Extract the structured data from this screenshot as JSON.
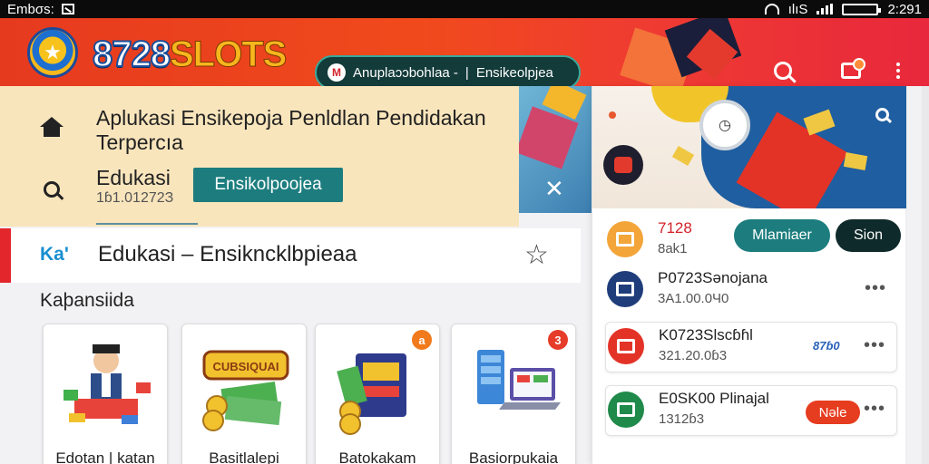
{
  "status_bar": {
    "left_text": "Embσs:",
    "time": "2:291",
    "network": "ılıS"
  },
  "header": {
    "logo_number": "8728",
    "logo_word": "SLOTS",
    "pill_icon": "M",
    "pill_left": "Anuplaɔɔbohlaa -",
    "pill_right": "Ensikeolpjea",
    "icons": [
      "search-icon",
      "chat-icon",
      "kebab-icon"
    ]
  },
  "hero": {
    "title": "Aplukasi Ensikepoja Penldlan Pendidakan Terpercıa",
    "edu_label": "Edukasi",
    "edu_sub": "1ɓ1.01272З",
    "edu_button": "Ensikolpoojea",
    "close_symbol": "✕"
  },
  "breadcrumb": {
    "prefix": "Ka'",
    "title": "Edukasi – Ensikncklbpieaa",
    "star": "☆"
  },
  "section": {
    "label": "Kaþansiida"
  },
  "cards": [
    {
      "label": "Edotan | katan",
      "badge": ""
    },
    {
      "label": "Basitlalepi",
      "badge": "",
      "art_text": "CUBSIQUAI"
    },
    {
      "label": "Batokakam",
      "badge": "a"
    },
    {
      "label": "Basiorpukaia",
      "badge": "3"
    }
  ],
  "panel": {
    "rows": [
      {
        "title": "7128",
        "sub": "8ak1",
        "btn1": "Mlamiaer",
        "btn2": "Sion",
        "icon_color": "#f3a53a"
      },
      {
        "title": "P0723Sənojana",
        "sub": "3Α1.00.0Ч0",
        "dots": "•••",
        "icon_color": "#1f3d7a"
      },
      {
        "title": "K0723Slscɓɦl",
        "sub": "321.20.0ɓ3",
        "dots": "•••",
        "mini_logo": "87ɓ0",
        "icon_color": "#e33327"
      },
      {
        "title": "E0SK00 Plinajal",
        "sub": "1312ɓ3",
        "dots": "•••",
        "btn": "Nəle",
        "icon_color": "#1f8a4a"
      }
    ]
  },
  "colors": {
    "brand_red": "#e63a1f",
    "teal": "#1d7d7e",
    "accent_blue": "#1a8fd1",
    "hero_bg": "#f9e5bc"
  }
}
